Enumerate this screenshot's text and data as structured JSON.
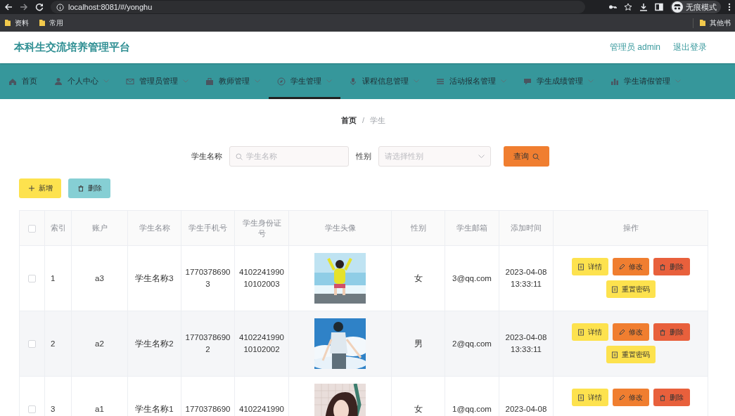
{
  "browser": {
    "address": "localhost:8081/#/yonghu",
    "profile": "无痕模式",
    "bookmarks": [
      "资料",
      "常用"
    ],
    "other_bookmarks": "其他书"
  },
  "header": {
    "title": "本科生交流培养管理平台",
    "user": "管理员 admin",
    "logout": "退出登录"
  },
  "nav": [
    {
      "label": "首页",
      "selected": false,
      "dropdown": false
    },
    {
      "label": "个人中心",
      "selected": false,
      "dropdown": true
    },
    {
      "label": "管理员管理",
      "selected": false,
      "dropdown": true
    },
    {
      "label": "教师管理",
      "selected": false,
      "dropdown": true
    },
    {
      "label": "学生管理",
      "selected": true,
      "dropdown": true
    },
    {
      "label": "课程信息管理",
      "selected": false,
      "dropdown": true
    },
    {
      "label": "活动报名管理",
      "selected": false,
      "dropdown": true
    },
    {
      "label": "学生成绩管理",
      "selected": false,
      "dropdown": true
    },
    {
      "label": "学生请假管理",
      "selected": false,
      "dropdown": true
    }
  ],
  "breadcrumb": {
    "items": [
      "首页",
      "学生"
    ],
    "separator": "/"
  },
  "search": {
    "fields": [
      {
        "label": "学生名称",
        "placeholder": "学生名称",
        "kind": "text"
      },
      {
        "label": "性别",
        "placeholder": "请选择性别",
        "kind": "select"
      }
    ],
    "button": "查询"
  },
  "actions": [
    {
      "label": "新增",
      "kind": "add"
    },
    {
      "label": "删除",
      "kind": "delete"
    }
  ],
  "table": {
    "select_all": {
      "checked": false
    },
    "columns": [
      "索引",
      "账户",
      "学生名称",
      "学生手机号",
      "学生身份证号",
      "学生头像",
      "性别",
      "学生邮箱",
      "添加时间",
      "操作"
    ],
    "rows": [
      {
        "checked": false,
        "index": "1",
        "account": "a3",
        "name": "学生名称3",
        "phone": "17703786903",
        "id_number": "410224199010102003",
        "gender": "女",
        "email": "3@qq.com",
        "added": "2023-04-08 13:33:11",
        "actions": [
          {
            "label": "详情",
            "kind": "detail"
          },
          {
            "label": "修改",
            "kind": "edit"
          },
          {
            "label": "删除",
            "kind": "delete"
          },
          {
            "label": "重置密码",
            "kind": "reset"
          }
        ]
      },
      {
        "checked": false,
        "index": "2",
        "account": "a2",
        "name": "学生名称2",
        "phone": "17703786902",
        "id_number": "410224199010102002",
        "gender": "男",
        "email": "2@qq.com",
        "added": "2023-04-08 13:33:11",
        "actions": [
          {
            "label": "详情",
            "kind": "detail"
          },
          {
            "label": "修改",
            "kind": "edit"
          },
          {
            "label": "删除",
            "kind": "delete"
          },
          {
            "label": "重置密码",
            "kind": "reset"
          }
        ]
      },
      {
        "checked": false,
        "index": "3",
        "account": "a1",
        "name": "学生名称1",
        "phone": "1770378690",
        "id_number": "4102241990",
        "gender": "女",
        "email": "1@qq.com",
        "added": "2023-04-08",
        "actions": [
          {
            "label": "详情",
            "kind": "detail"
          },
          {
            "label": "修改",
            "kind": "edit"
          },
          {
            "label": "删除",
            "kind": "delete"
          }
        ]
      }
    ]
  }
}
